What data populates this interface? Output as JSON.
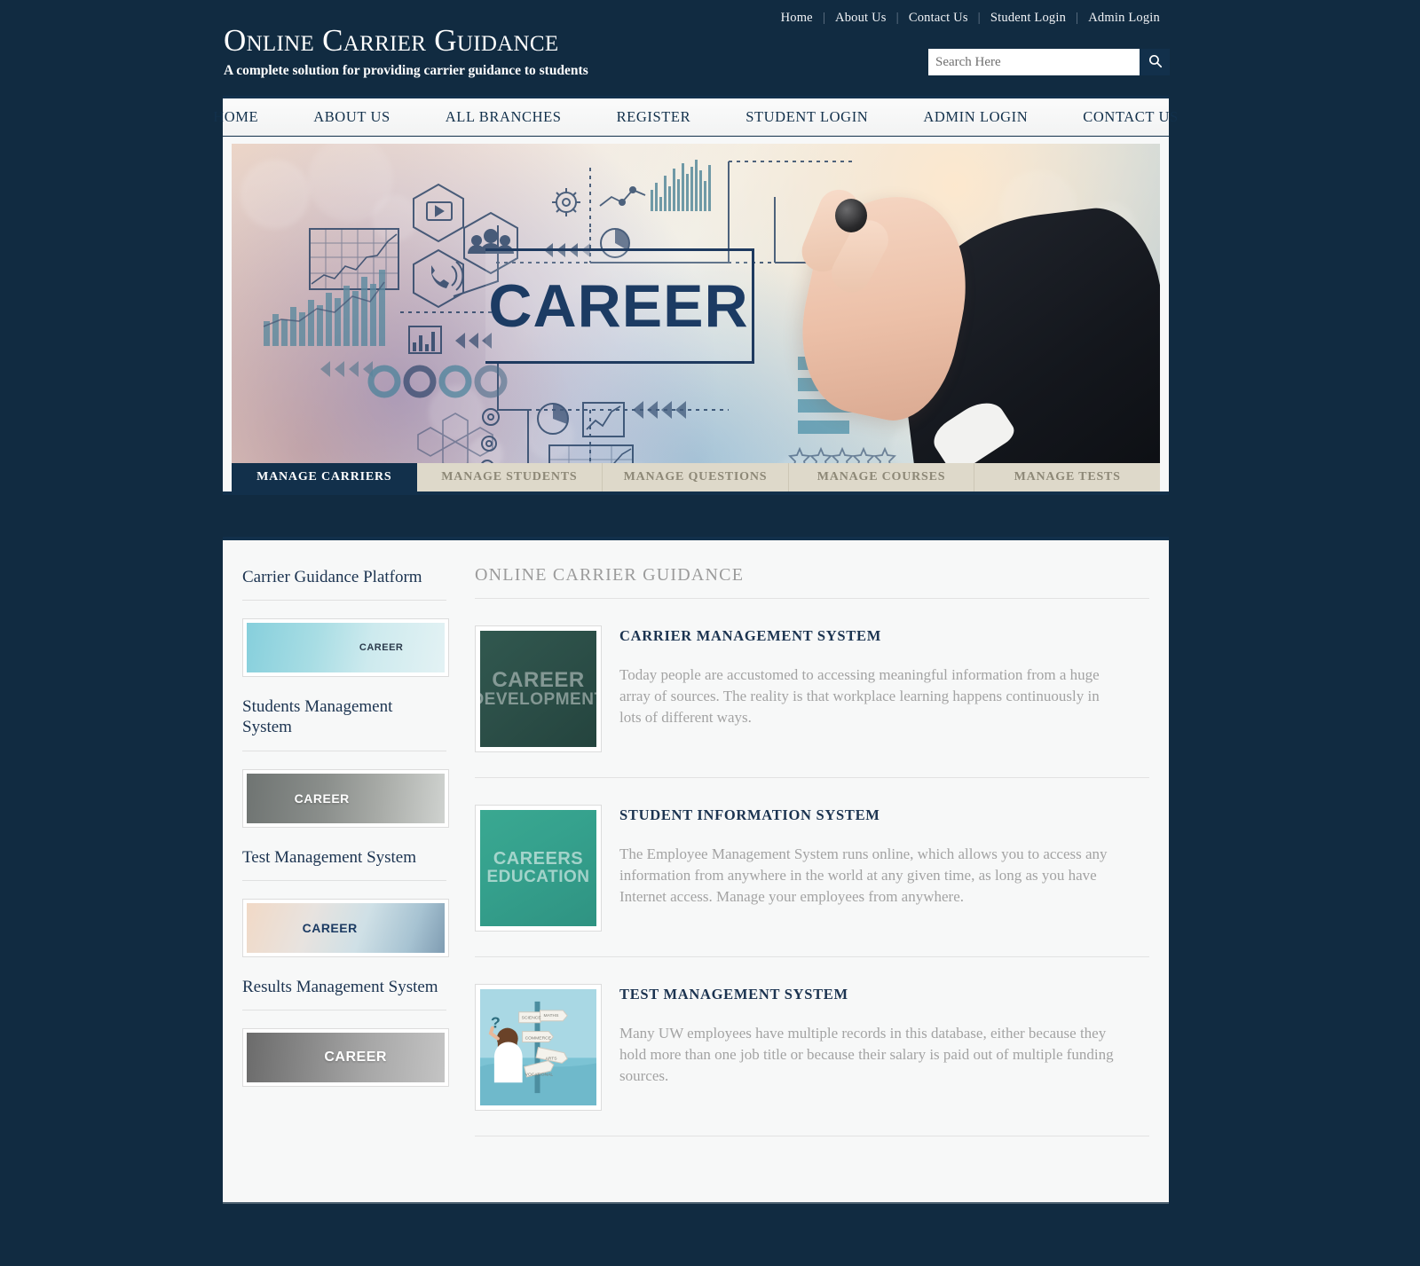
{
  "topbar": {
    "links": [
      {
        "label": "Home",
        "name": "top-link-home"
      },
      {
        "label": "About Us",
        "name": "top-link-about-us"
      },
      {
        "label": "Contact Us",
        "name": "top-link-contact-us"
      },
      {
        "label": "Student Login",
        "name": "top-link-student-login"
      },
      {
        "label": "Admin Login",
        "name": "top-link-admin-login"
      }
    ],
    "separator": "|"
  },
  "brand": {
    "title": "Online Carrier Guidance",
    "tagline": "A complete solution for providing carrier guidance to students"
  },
  "search": {
    "placeholder": "Search Here",
    "value": "",
    "icon": "search-icon"
  },
  "nav": {
    "items": [
      {
        "label": "HOME",
        "name": "nav-home"
      },
      {
        "label": "ABOUT US",
        "name": "nav-about-us"
      },
      {
        "label": "ALL BRANCHES",
        "name": "nav-all-branches"
      },
      {
        "label": "REGISTER",
        "name": "nav-register"
      },
      {
        "label": "STUDENT LOGIN",
        "name": "nav-student-login"
      },
      {
        "label": "ADMIN LOGIN",
        "name": "nav-admin-login"
      },
      {
        "label": "CONTACT US",
        "name": "nav-contact-us"
      }
    ]
  },
  "banner": {
    "headline": "CAREER",
    "alt": "Businessman drawing career infographics on glass screen"
  },
  "tabs": [
    {
      "label": "MANAGE CARRIERS",
      "active": true
    },
    {
      "label": "MANAGE STUDENTS",
      "active": false
    },
    {
      "label": "MANAGE QUESTIONS",
      "active": false
    },
    {
      "label": "MANAGE COURSES",
      "active": false
    },
    {
      "label": "MANAGE TESTS",
      "active": false
    }
  ],
  "sidebar": {
    "items": [
      {
        "title": "Carrier Guidance Platform",
        "thumb_label": "CAREER"
      },
      {
        "title": "Students Management System",
        "thumb_label": "CAREER"
      },
      {
        "title": "Test Management System",
        "thumb_label": "CAREER"
      },
      {
        "title": "Results Management System",
        "thumb_label": "CAREER"
      }
    ]
  },
  "main": {
    "heading": "ONLINE CARRIER GUIDANCE",
    "articles": [
      {
        "title": "CARRIER MANAGEMENT SYSTEM",
        "text": "Today people are accustomed to accessing meaningful information from a huge array of sources. The reality is that workplace learning happens continuously in lots of different ways.",
        "thumb_line1": "CAREER",
        "thumb_line2": "DEVELOPMENT"
      },
      {
        "title": "STUDENT INFORMATION SYSTEM",
        "text": "The Employee Management System runs online, which allows you to access any information from anywhere in the world at any given time, as long as you have Internet access. Manage your employees from anywhere.",
        "thumb_line1": "CAREERS",
        "thumb_line2": "EDUCATION"
      },
      {
        "title": "TEST MANAGEMENT SYSTEM",
        "text": "Many UW employees have multiple records in this database, either because they hold more than one job title or because their salary is paid out of multiple funding sources.",
        "thumb_line1": "",
        "thumb_line2": ""
      }
    ]
  },
  "colors": {
    "page_background": "#112b41",
    "accent_dark": "#12304b",
    "card_background": "#f7f8f8",
    "tab_inactive": "#ded9ca",
    "tab_inactive_text": "#8d8877",
    "body_text": "#a3a3a3",
    "heading_text": "#1b3350"
  }
}
